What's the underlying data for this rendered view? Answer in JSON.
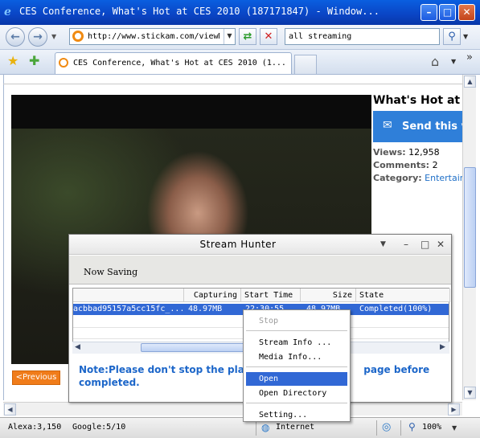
{
  "window": {
    "title": "CES Conference, What's Hot at CES 2010 (187171847) - Window...",
    "controls": [
      "minimize",
      "maximize",
      "close"
    ]
  },
  "navigation": {
    "address": "http://www.stickam.com/viewM",
    "search_query": "all streaming",
    "refresh_icon": "refresh-icon",
    "stop_icon": "stop-icon"
  },
  "tabs": {
    "active_label": "CES Conference, What's Hot at CES 2010 (1..."
  },
  "page": {
    "video_title": "What's Hot at C",
    "send_button": "Send this v",
    "views_label": "Views:",
    "views_value": "12,958",
    "comments_label": "Comments:",
    "comments_value": "2",
    "category_label": "Category:",
    "category_value": "Entertainn",
    "previous_button": "<Previous"
  },
  "stream_hunter": {
    "title": "Stream Hunter",
    "status": "Now Saving",
    "columns": [
      "Capturing",
      "Start Time",
      "Size",
      "State"
    ],
    "row": {
      "name": "acbbad95157a5cc15fc_...",
      "capturing": "48.97MB",
      "start_time": "22:30:55",
      "size": "48.97MB",
      "state": "Completed(100%)"
    },
    "note": "Note:Please don't stop the play",
    "note_tail": "page before",
    "note_line2": "completed."
  },
  "context_menu": {
    "items": [
      "Stop",
      "Stream Info ...",
      "Media Info...",
      "Open",
      "Open Directory",
      "Setting..."
    ]
  },
  "status_bar": {
    "alexa": "Alexa:3,150",
    "google": "Google:5/10",
    "zone": "Internet",
    "zoom": "100%"
  }
}
